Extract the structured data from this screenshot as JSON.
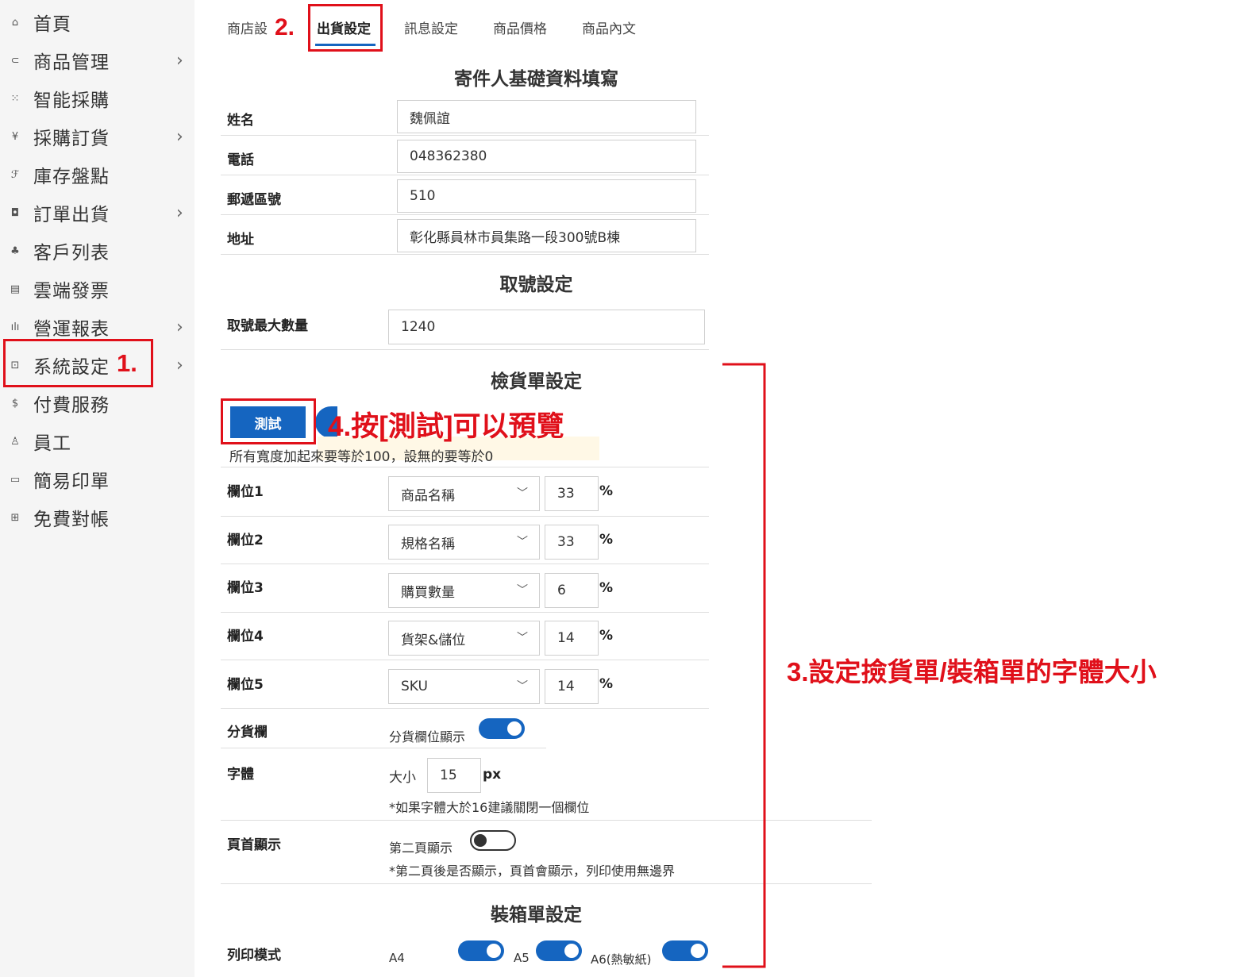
{
  "sidebar": {
    "items": [
      {
        "icon": "⌂",
        "icon_name": "home-icon",
        "label": "首頁",
        "chevron": false
      },
      {
        "icon": "⊂",
        "icon_name": "products-icon",
        "label": "商品管理",
        "chevron": true
      },
      {
        "icon": "⁙",
        "icon_name": "smart-purchase-icon",
        "label": "智能採購",
        "chevron": false
      },
      {
        "icon": "¥",
        "icon_name": "cart-icon",
        "label": "採購訂貨",
        "chevron": true
      },
      {
        "icon": "ℱ",
        "icon_name": "inventory-icon",
        "label": "庫存盤點",
        "chevron": false
      },
      {
        "icon": "◘",
        "icon_name": "order-icon",
        "label": "訂單出貨",
        "chevron": true
      },
      {
        "icon": "♣",
        "icon_name": "customers-icon",
        "label": "客戶列表",
        "chevron": false
      },
      {
        "icon": "▤",
        "icon_name": "invoice-icon",
        "label": "雲端發票",
        "chevron": false
      },
      {
        "icon": "ılı",
        "icon_name": "report-icon",
        "label": "營運報表",
        "chevron": true
      },
      {
        "icon": "⊡",
        "icon_name": "settings-icon",
        "label": "系統設定",
        "chevron": true
      },
      {
        "icon": "$",
        "icon_name": "dollar-icon",
        "label": "付費服務",
        "chevron": false
      },
      {
        "icon": "♙",
        "icon_name": "staff-icon",
        "label": "員工",
        "chevron": false
      },
      {
        "icon": "▭",
        "icon_name": "print-icon",
        "label": "簡易印單",
        "chevron": false
      },
      {
        "icon": "⊞",
        "icon_name": "reconcile-icon",
        "label": "免費對帳",
        "chevron": false
      }
    ],
    "chevron_glyph": "›"
  },
  "tabs": [
    "商店設",
    "出貨設定",
    "訊息設定",
    "商品價格",
    "商品內文"
  ],
  "annotations": {
    "step1": "1.",
    "step2": "2.",
    "step3": "3.設定撿貨單/裝箱單的字體大小",
    "step4": "4.按[測試]可以預覽"
  },
  "sender": {
    "title": "寄件人基礎資料填寫",
    "fields": [
      {
        "label": "姓名",
        "value": "魏佩誼"
      },
      {
        "label": "電話",
        "value": "048362380"
      },
      {
        "label": "郵遞區號",
        "value": "510"
      },
      {
        "label": "地址",
        "value": "彰化縣員林市員集路一段300號B棟"
      }
    ]
  },
  "numbering": {
    "title": "取號設定",
    "label": "取號最大數量",
    "value": "1240"
  },
  "picking": {
    "title": "檢貨單設定",
    "test_button": "測試",
    "hint": "所有寬度加起來要等於100，設無的要等於0",
    "pct_symbol": "%",
    "columns": [
      {
        "label": "欄位1",
        "select": "商品名稱",
        "width": "33"
      },
      {
        "label": "欄位2",
        "select": "規格名稱",
        "width": "33"
      },
      {
        "label": "欄位3",
        "select": "購買數量",
        "width": "6"
      },
      {
        "label": "欄位4",
        "select": "貨架&儲位",
        "width": "14"
      },
      {
        "label": "欄位5",
        "select": "SKU",
        "width": "14"
      }
    ],
    "divider": {
      "label": "分貨欄",
      "toggle_label": "分貨欄位顯示",
      "on": true
    },
    "font": {
      "label": "字體",
      "size_label": "大小",
      "size": "15",
      "unit": "px",
      "note": "*如果字體大於16建議關閉一個欄位"
    },
    "header": {
      "label": "頁首顯示",
      "toggle_label": "第二頁顯示",
      "on": false,
      "note": "*第二頁後是否顯示，頁首會顯示，列印使用無邊界"
    }
  },
  "packing": {
    "title": "裝箱單設定",
    "print_mode_label": "列印模式",
    "options": [
      {
        "label": "A4",
        "on": true
      },
      {
        "label": "A5",
        "on": true
      },
      {
        "label": "A6(熱敏紙)",
        "on": true
      }
    ]
  },
  "colors": {
    "accent": "#1565c0",
    "annotation": "#e0101a"
  }
}
